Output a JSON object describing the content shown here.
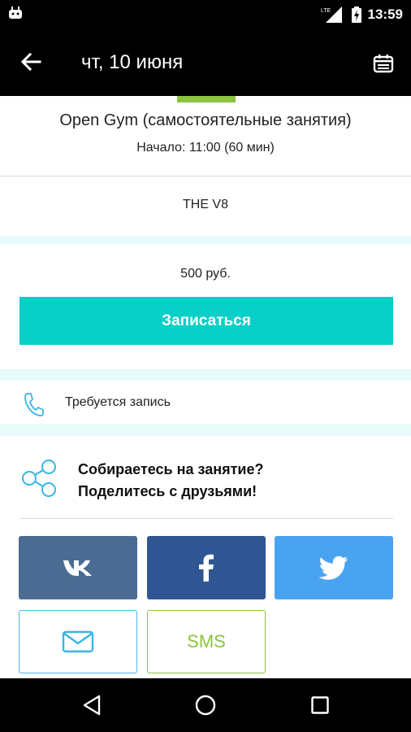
{
  "status_bar": {
    "network": "LTE",
    "time": "13:59"
  },
  "app_bar": {
    "title": "чт, 10 июня",
    "back_icon": "arrow-left-icon",
    "calendar_icon": "calendar-icon"
  },
  "event": {
    "name": "Open Gym (самостоятельные занятия)",
    "start": "Начало: 11:00 (60 мин)",
    "venue": "THE V8"
  },
  "booking": {
    "price": "500 руб.",
    "signup_label": "Записаться"
  },
  "info": {
    "phone_text": "Требуется запись"
  },
  "share": {
    "line1": "Собираетесь на занятие?",
    "line2": "Поделитесь с друзьями!",
    "sms_label": "SMS"
  },
  "colors": {
    "accent": "#08cfc7",
    "green": "#8ac43f",
    "vk": "#4a6c92",
    "facebook": "#2f5592",
    "twitter": "#4aa3f0",
    "mail_border": "#4db8ea",
    "background": "#e6fbfa"
  }
}
